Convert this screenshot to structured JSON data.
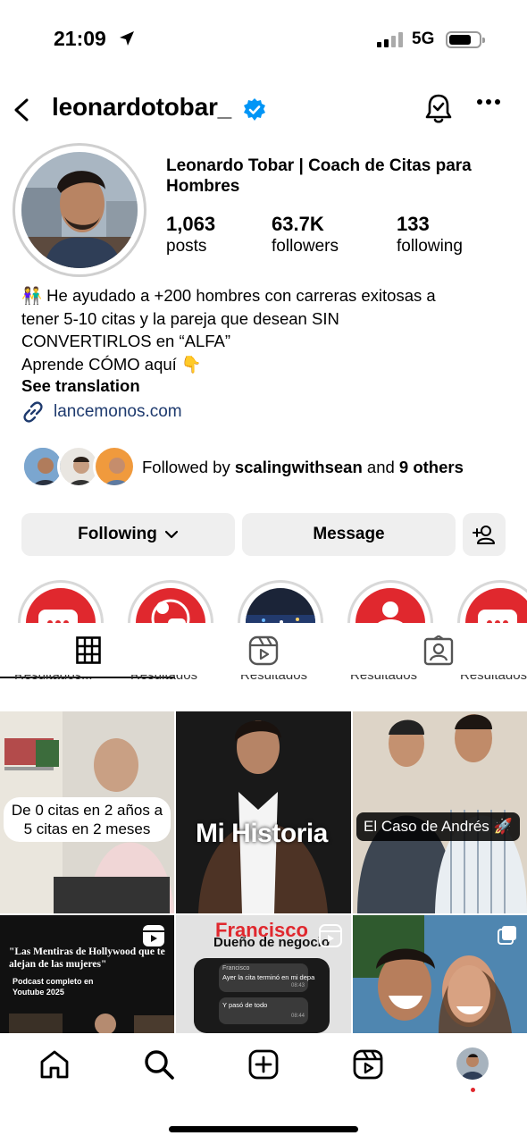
{
  "status_bar": {
    "time": "21:09",
    "network": "5G"
  },
  "header": {
    "username": "leonardotobar_"
  },
  "profile": {
    "display_name": "Leonardo Tobar | Coach de Citas para Hombres",
    "stats": [
      {
        "value": "1,063",
        "label": "posts"
      },
      {
        "value": "63.7K",
        "label": "followers"
      },
      {
        "value": "133",
        "label": "following"
      }
    ],
    "bio_lines": [
      "👫 He ayudado a +200 hombres con carreras exitosas a",
      "tener 5-10 citas y la pareja que desean SIN",
      "CONVERTIRLOS en “ALFA”",
      "Aprende CÓMO aquí 👇"
    ],
    "see_translation": "See translation",
    "link": "lancemonos.com",
    "followed_by_prefix": "Followed by ",
    "followed_by_user": "scalingwithsean",
    "followed_by_and": " and ",
    "followed_by_others": "9 others"
  },
  "buttons": {
    "following": "Following",
    "message": "Message"
  },
  "highlights": {
    "labels": [
      "Resultados...",
      "Resultados",
      "Resultados",
      "Resultados",
      "Resultados"
    ]
  },
  "posts": [
    {
      "caption": "De 0 citas en 2 años a 5 citas en 2 meses"
    },
    {
      "caption": "Mi Historia"
    },
    {
      "caption": "El Caso de Andrés 🚀"
    },
    {
      "caption_line1": "\"Las Mentiras de Hollywood que te alejan de las mujeres\"",
      "caption_line2": "Podcast completo en Youtube 2025"
    },
    {
      "caption_name": "Francisco",
      "caption_role": "Dueño de negocio",
      "chat_sender": "Francisco",
      "chat_msg1": "Ayer la cita terminó en mi depa",
      "chat_time1": "08:43",
      "chat_msg2": "Y pasó de todo",
      "chat_time2": "08:44"
    },
    {
      "caption": ""
    }
  ],
  "colors": {
    "accent_blue": "#0095f6",
    "highlight_red": "#e0282e",
    "link": "#1e3a6e"
  }
}
